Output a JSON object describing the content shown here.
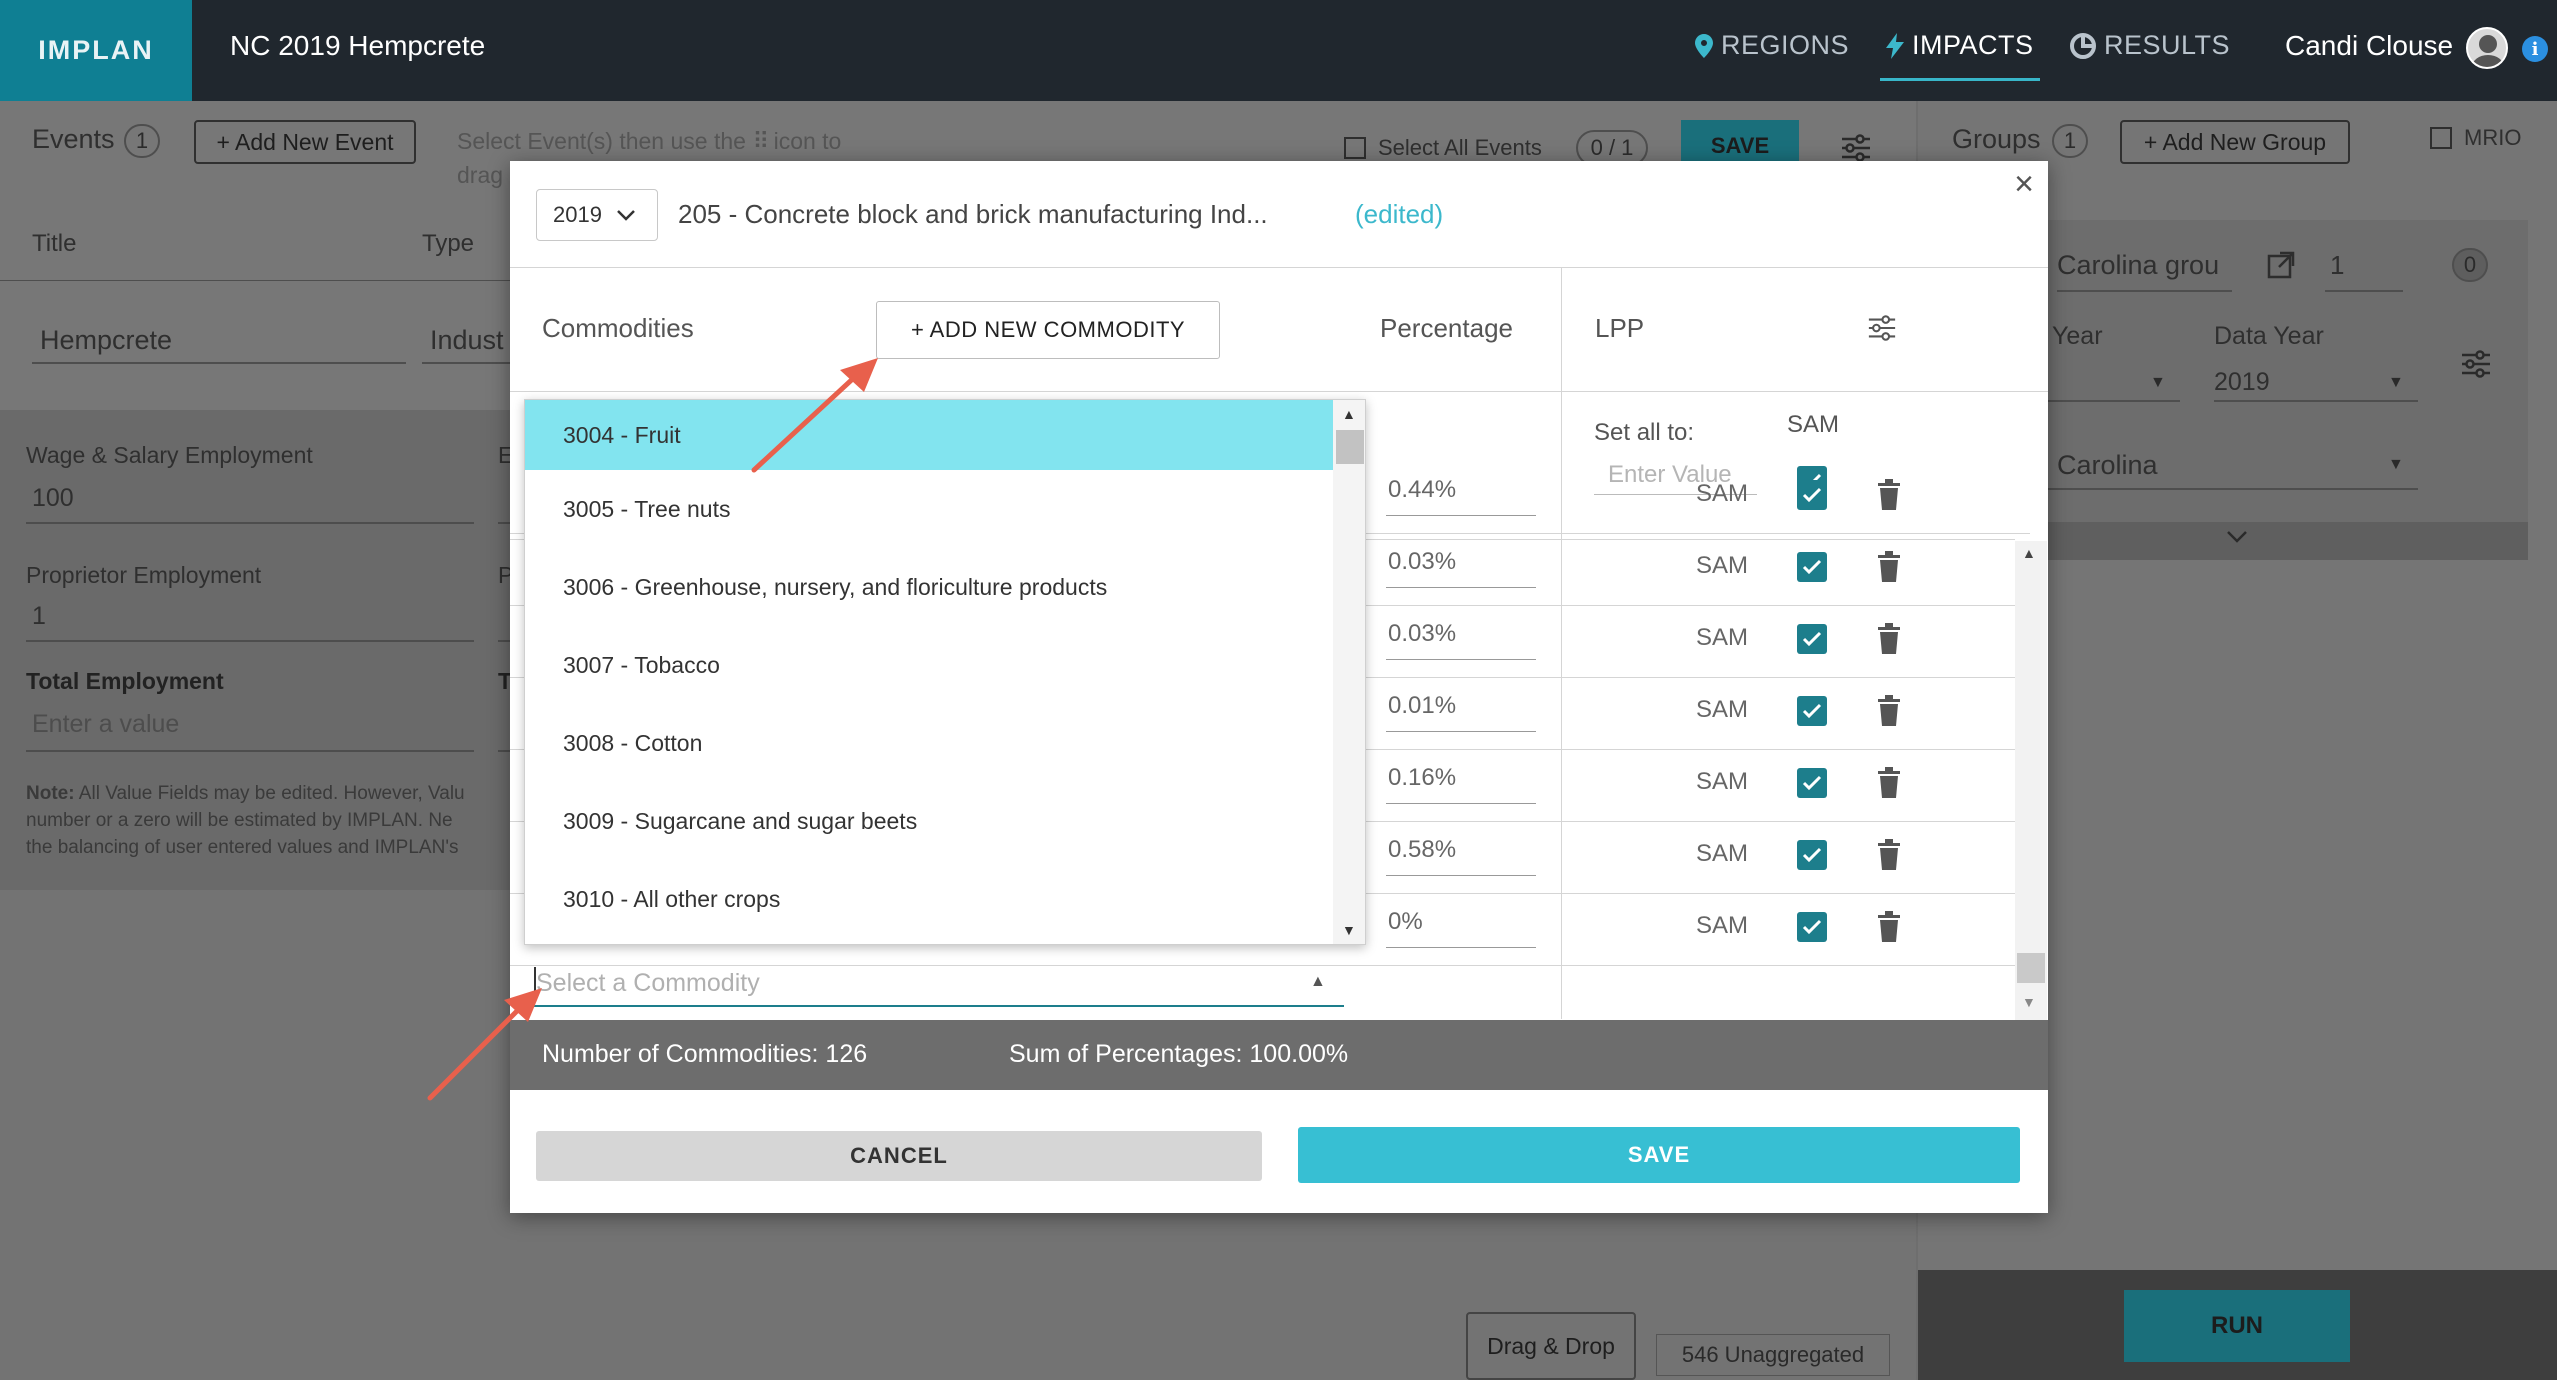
{
  "topbar": {
    "logo": "IMPLAN",
    "project_title": "NC 2019 Hempcrete",
    "nav": {
      "regions": "REGIONS",
      "impacts": "IMPACTS",
      "results": "RESULTS"
    },
    "user_name": "Candi Clouse",
    "info": "i"
  },
  "events_panel": {
    "events_label": "Events",
    "events_count": "1",
    "add_event": "+ Add New Event",
    "hint": "Select Event(s) then use the",
    "hint_tail": "icon to",
    "hint_line2": "drag",
    "select_all": "Select All Events",
    "selected_count": "0 / 1",
    "save": "SAVE",
    "col_title": "Title",
    "col_type": "Type",
    "event_title": "Hempcrete",
    "event_type": "Indust",
    "wage_label": "Wage & Salary Employment",
    "wage_value": "100",
    "wage_col2": "E",
    "prop_label": "Proprietor Employment",
    "prop_value": "1",
    "prop_col2": "P",
    "total_label": "Total Employment",
    "total_placeholder": "Enter a value",
    "total_col2": "T",
    "note_bold": "Note:",
    "note_text": "All Value Fields may be edited. However, Valu",
    "note_line2": "number or a zero will be estimated by IMPLAN. Ne",
    "note_line3": "the balancing of user entered values and IMPLAN's",
    "drag_drop": "Drag & Drop",
    "unaggregated": "546 Unaggregated"
  },
  "groups_panel": {
    "groups_label": "Groups",
    "groups_count": "1",
    "add_group": "+ Add New Group",
    "mrio": "MRIO",
    "group_name": "Carolina grou",
    "group_num": "1",
    "group_badge": "0",
    "event_year_label": "Year",
    "data_year_label": "Data Year",
    "data_year_value": "2019",
    "region_value": "Carolina",
    "run": "RUN"
  },
  "modal": {
    "year": "2019",
    "industry": "205 - Concrete block and brick manufacturing Ind...",
    "edited": "(edited)",
    "commodities_header": "Commodities",
    "add_commodity": "+ ADD NEW COMMODITY",
    "percentage_header": "Percentage",
    "lpp_header": "LPP",
    "set_all_label": "Set all to:",
    "sam_header": "SAM",
    "set_all_placeholder": "Enter Value",
    "rows": [
      {
        "pct": "0.44%",
        "lpp": "SAM"
      },
      {
        "pct": "0.03%",
        "lpp": "SAM"
      },
      {
        "pct": "0.03%",
        "lpp": "SAM"
      },
      {
        "pct": "0.01%",
        "lpp": "SAM"
      },
      {
        "pct": "0.16%",
        "lpp": "SAM"
      },
      {
        "pct": "0.58%",
        "lpp": "SAM"
      },
      {
        "pct": "0%",
        "lpp": "SAM"
      }
    ],
    "dropdown_options": [
      "3004 - Fruit",
      "3005 - Tree nuts",
      "3006 - Greenhouse, nursery, and floriculture products",
      "3007 - Tobacco",
      "3008 - Cotton",
      "3009 - Sugarcane and sugar beets",
      "3010 - All other crops"
    ],
    "select_placeholder": "Select a Commodity",
    "num_commodities": "Number of Commodities: 126",
    "sum_percentages": "Sum of Percentages: 100.00%",
    "cancel": "CANCEL",
    "save": "SAVE"
  },
  "colors": {
    "teal": "#37bfd3",
    "dark_teal": "#1d7e8c",
    "highlight": "#82e4ef",
    "arrow": "#e8604c",
    "topbar": "#20272e"
  }
}
